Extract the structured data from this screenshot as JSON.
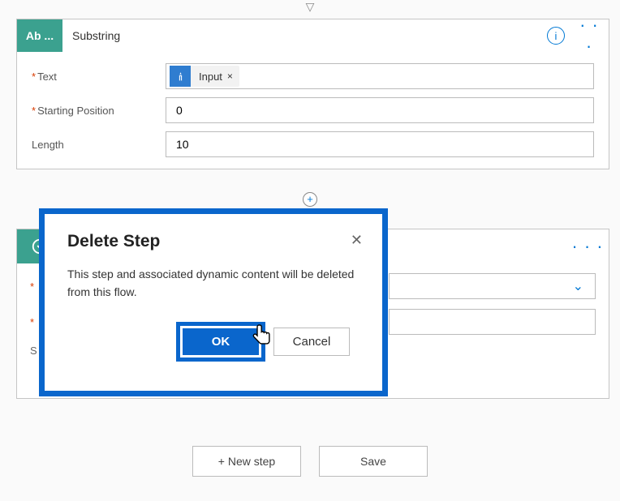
{
  "topArrow": "▽",
  "substringCard": {
    "iconLabel": "Ab ...",
    "title": "Substring",
    "infoGlyph": "i",
    "moreGlyph": "· · ·",
    "fields": {
      "textLabel": "Text",
      "token": {
        "icon": "👆",
        "label": "Input",
        "x": "×"
      },
      "startLabel": "Starting Position",
      "startValue": "0",
      "lengthLabel": "Length",
      "lengthValue": "10"
    }
  },
  "addGlyph": "+",
  "secondCard": {
    "moreGlyph": "· · ·",
    "hiddenRows": {
      "req": "*",
      "chevron": "⌄",
      "staticS": "S"
    }
  },
  "dialog": {
    "title": "Delete Step",
    "closeGlyph": "✕",
    "message": "This step and associated dynamic content will be deleted from this flow.",
    "ok": "OK",
    "cancel": "Cancel"
  },
  "footer": {
    "newStep": "+ New step",
    "save": "Save"
  }
}
